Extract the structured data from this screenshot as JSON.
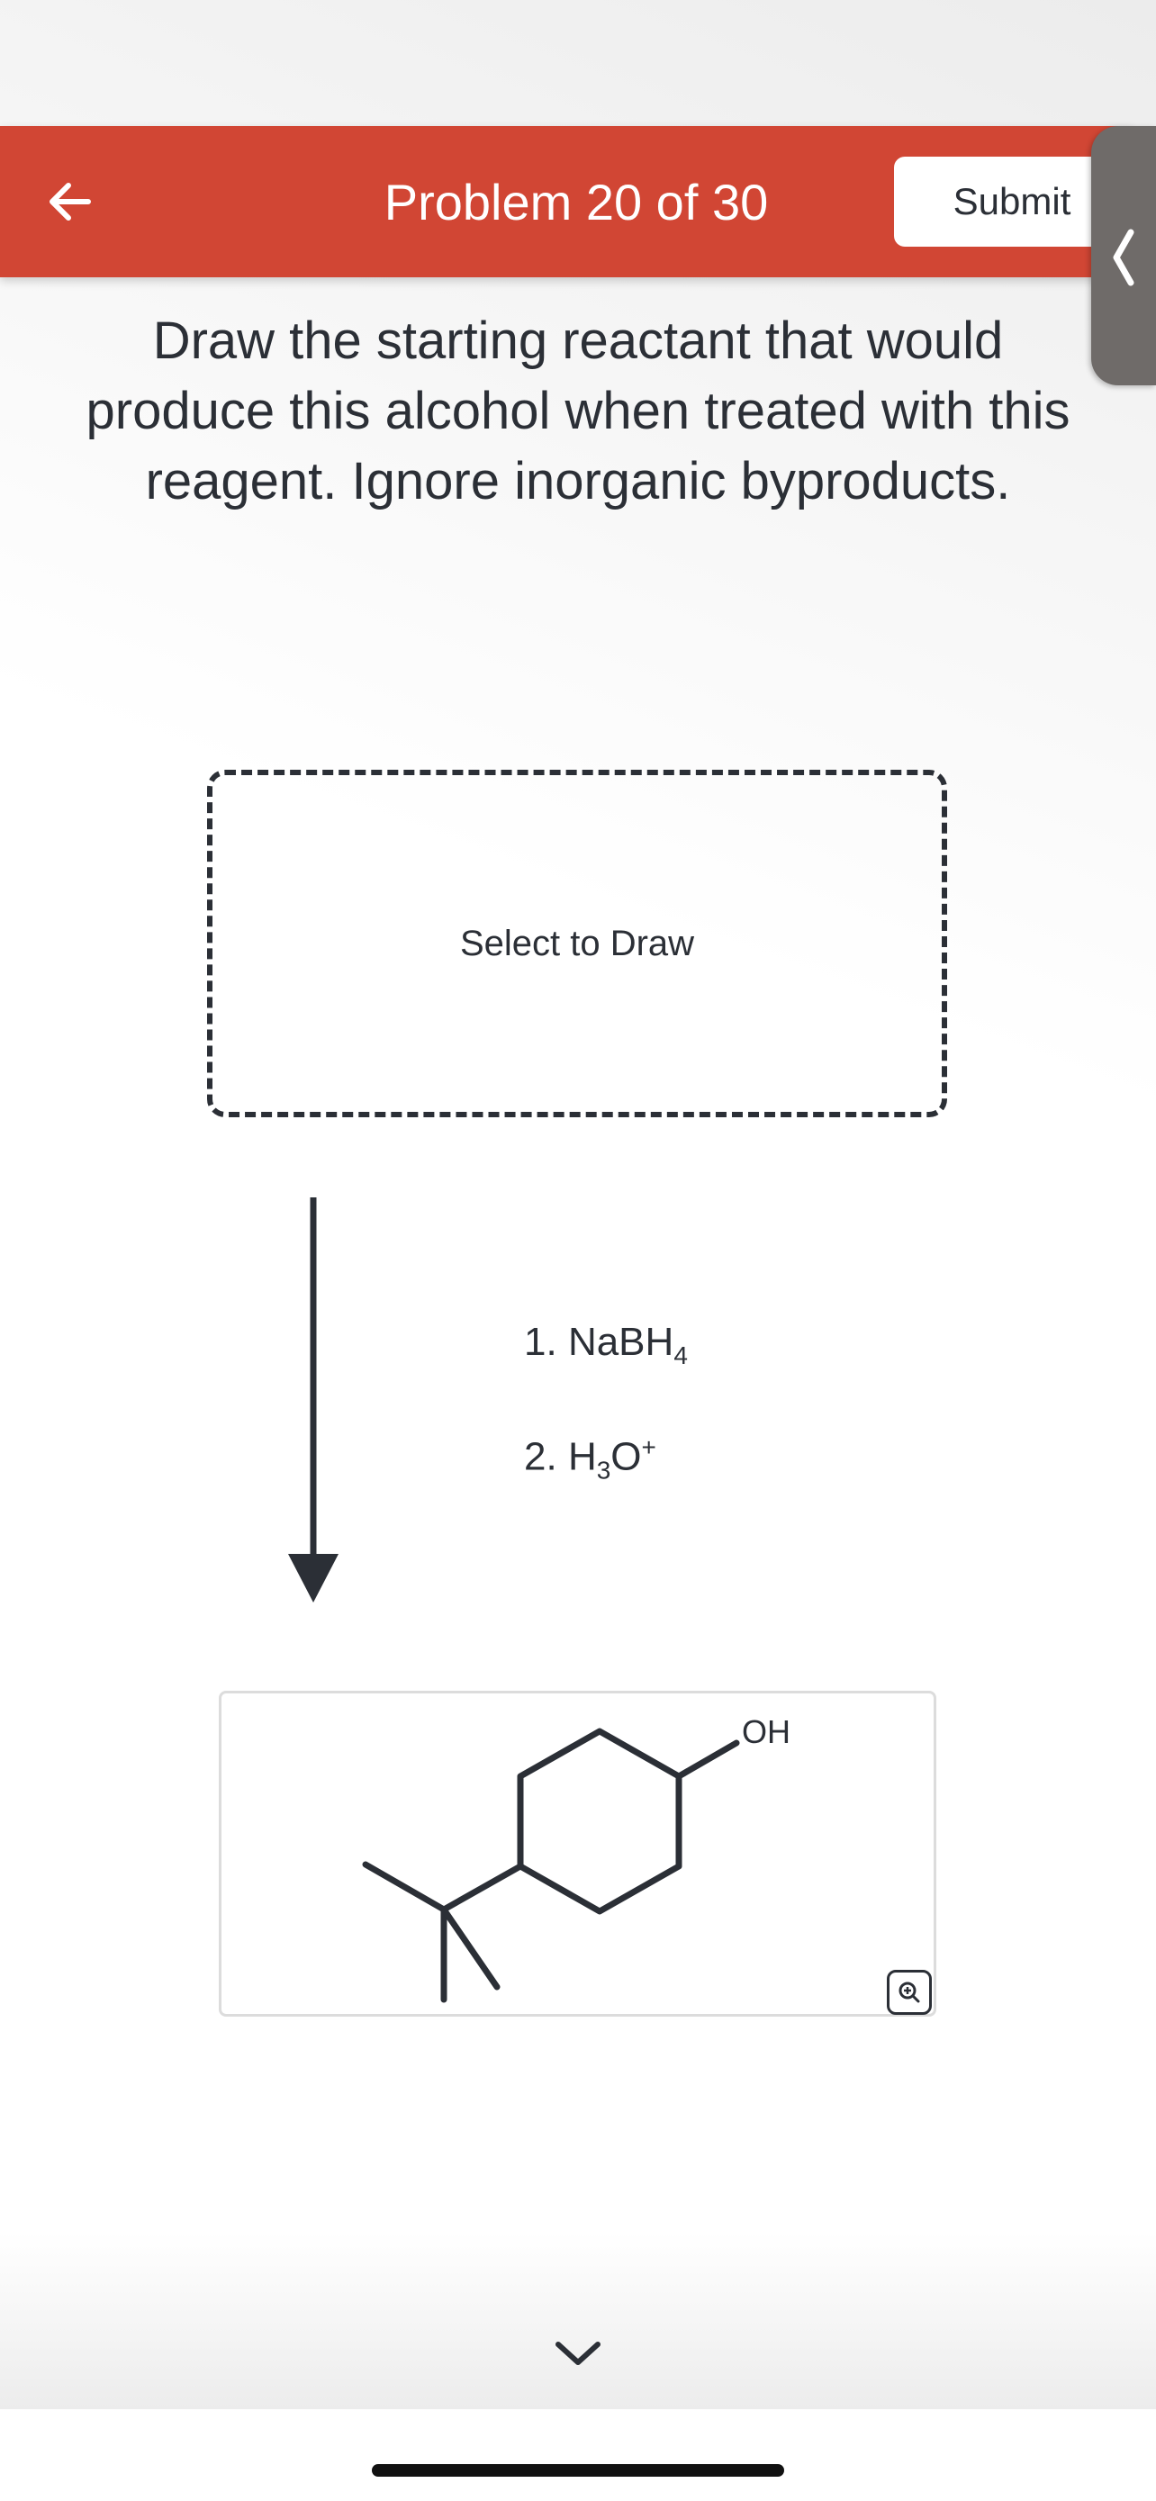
{
  "header": {
    "title": "Problem 20 of 30",
    "submit_label": "Submit",
    "accent_color": "#d14634",
    "back_icon": "arrow-left-icon",
    "side_tab_icon": "chevron-left-icon"
  },
  "question": {
    "text": "Draw the starting reactant that would produce this alcohol when treated with this reagent. Ignore inorganic byproducts."
  },
  "draw_area": {
    "label": "Select to Draw"
  },
  "reagents": [
    {
      "step": "1.",
      "formula_a": "NaBH",
      "sub": "4",
      "sup": ""
    },
    {
      "step": "2.",
      "formula_a": "H",
      "sub": "3",
      "formula_b": "O",
      "sup": "+"
    }
  ],
  "product": {
    "oh_label": "OH",
    "zoom_icon": "zoom-in-icon"
  },
  "footer": {
    "next_icon": "chevron-down-icon"
  }
}
